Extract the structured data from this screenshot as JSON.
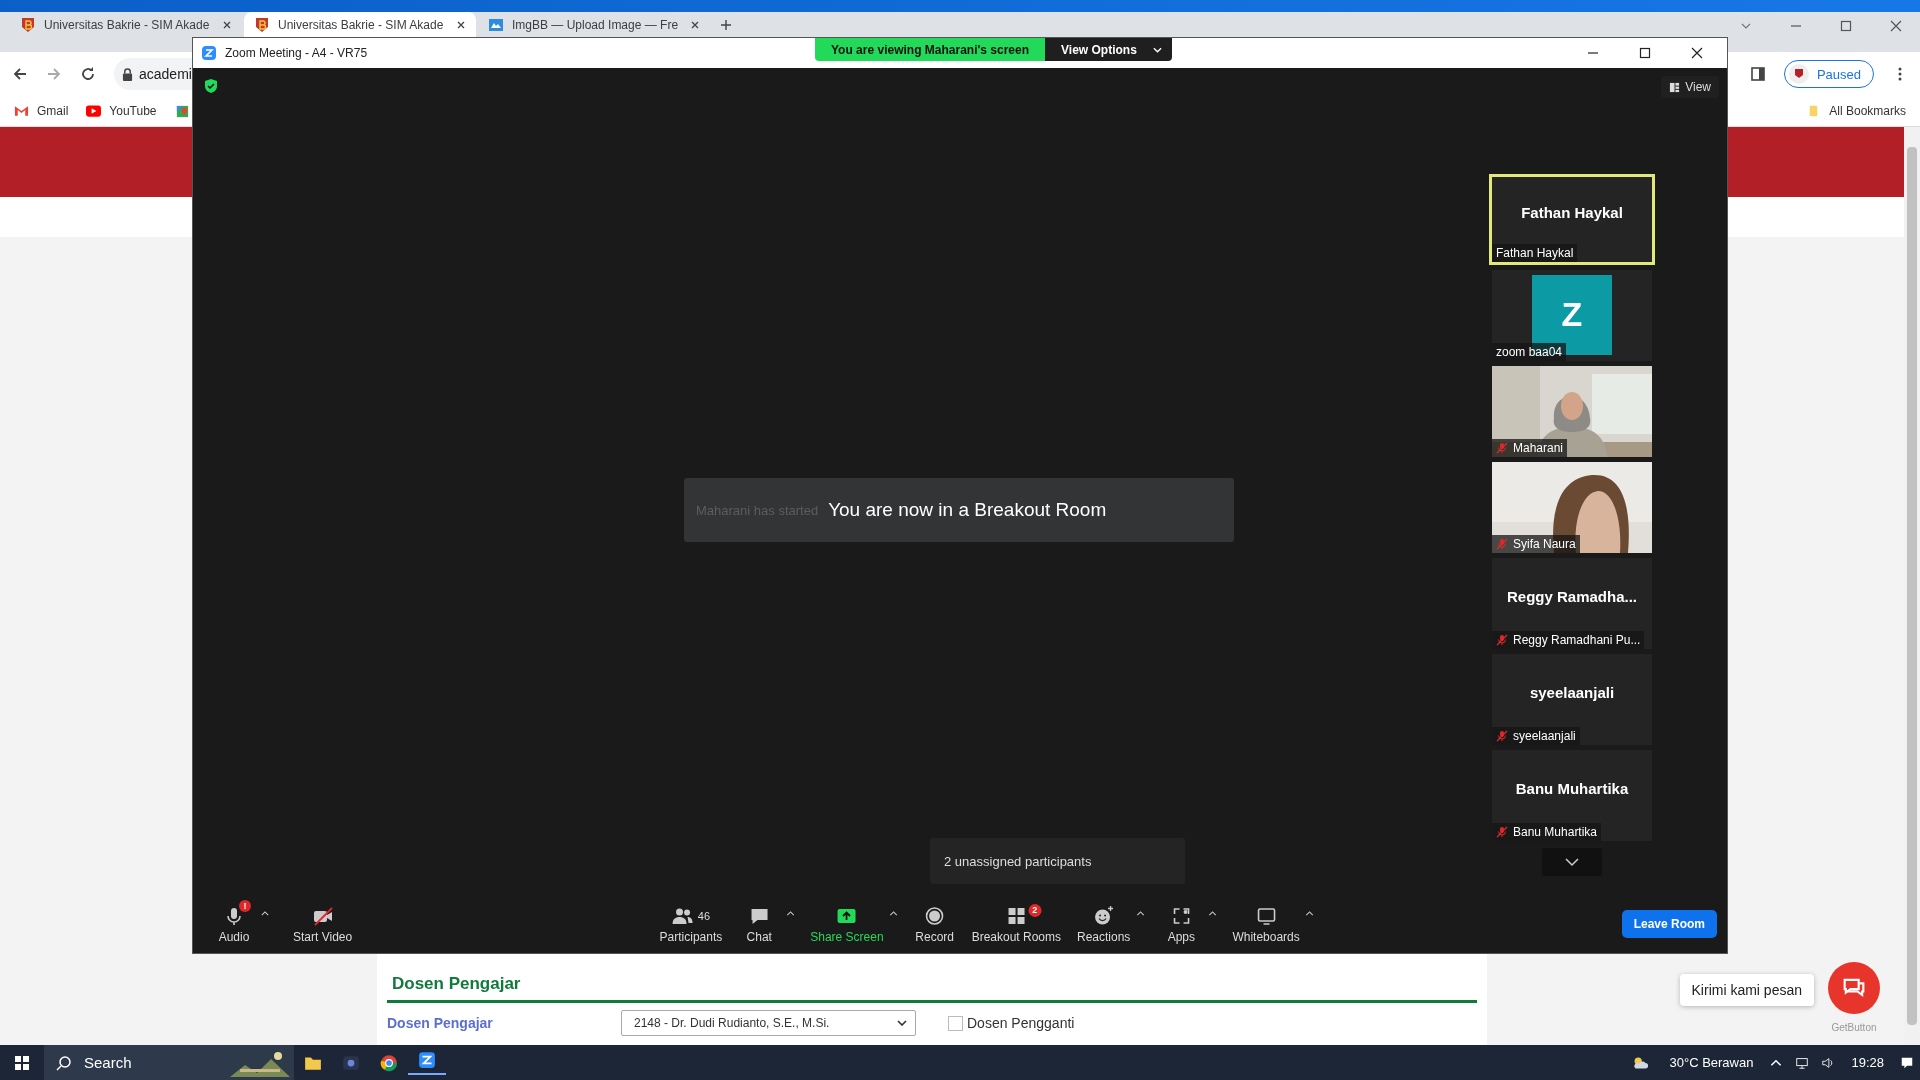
{
  "browser": {
    "tabs": [
      {
        "title": "Universitas Bakrie - SIM Akade",
        "kind": "bakrie",
        "selected": false
      },
      {
        "title": "Universitas Bakrie - SIM Akade",
        "kind": "bakrie",
        "selected": true
      },
      {
        "title": "ImgBB — Upload Image — Fre",
        "kind": "imgbb",
        "selected": false
      }
    ],
    "address": "academi",
    "bookmarks": [
      {
        "label": "Gmail",
        "kind": "gmail"
      },
      {
        "label": "YouTube",
        "kind": "youtube"
      },
      {
        "kind": "maps"
      }
    ],
    "profile_status": "Paused",
    "all_bookmarks": "All Bookmarks"
  },
  "zoom": {
    "title": "Zoom Meeting - A4 - VR75",
    "share_banner": "You are viewing Maharani's screen",
    "view_options": "View Options",
    "view_button": "View",
    "notice_faded": "Maharani has started",
    "notice": "You are now in a Breakout Room",
    "tooltip": "2 unassigned participants",
    "participants": [
      {
        "kind": "name",
        "title": "Fathan Haykal",
        "name": "Fathan Haykal",
        "muted": false,
        "speaking": true
      },
      {
        "kind": "avatar",
        "initial": "Z",
        "name": "zoom baa04",
        "muted": false,
        "speaking": false
      },
      {
        "kind": "video",
        "name": "Maharani",
        "muted": true,
        "speaking": false
      },
      {
        "kind": "video2",
        "name": "Syifa Naura",
        "muted": true,
        "speaking": false
      },
      {
        "kind": "name",
        "title": "Reggy  Ramadha...",
        "name": "Reggy Ramadhani Pu...",
        "muted": true,
        "speaking": false
      },
      {
        "kind": "name",
        "title": "syeelaanjali",
        "name": "syeelaanjali",
        "muted": true,
        "speaking": false
      },
      {
        "kind": "name",
        "title": "Banu Muhartika",
        "name": "Banu Muhartika",
        "muted": true,
        "speaking": false
      }
    ],
    "toolbar_left": [
      {
        "kind": "audio",
        "label": "Audio",
        "badge": "!",
        "caret": true
      },
      {
        "kind": "video",
        "label": "Start Video",
        "caret": false
      }
    ],
    "toolbar": [
      {
        "kind": "participants",
        "label": "Participants",
        "count": "46",
        "caret": false
      },
      {
        "kind": "chat",
        "label": "Chat",
        "caret": true
      },
      {
        "kind": "share",
        "label": "Share Screen",
        "caret": true
      },
      {
        "kind": "record",
        "label": "Record",
        "caret": false
      },
      {
        "kind": "breakout",
        "label": "Breakout Rooms",
        "badge": "2",
        "caret": false
      },
      {
        "kind": "reactions",
        "label": "Reactions",
        "caret": true
      },
      {
        "kind": "apps",
        "label": "Apps",
        "caret": true
      },
      {
        "kind": "whiteboards",
        "label": "Whiteboards",
        "caret": true
      }
    ],
    "leave": "Leave Room"
  },
  "page": {
    "section": "Dosen Pengajar",
    "field_label": "Dosen Pengajar",
    "select": "2148 - Dr. Dudi Rudianto, S.E., M.Si.",
    "substitute": {
      "label": "Dosen Pengganti",
      "checked": false
    },
    "chat_bubble": "Kirimi kami pesan",
    "getbutton": "GetButton"
  },
  "taskbar": {
    "search": "Search",
    "weather": "30°C Berawan",
    "time": "19:28"
  }
}
